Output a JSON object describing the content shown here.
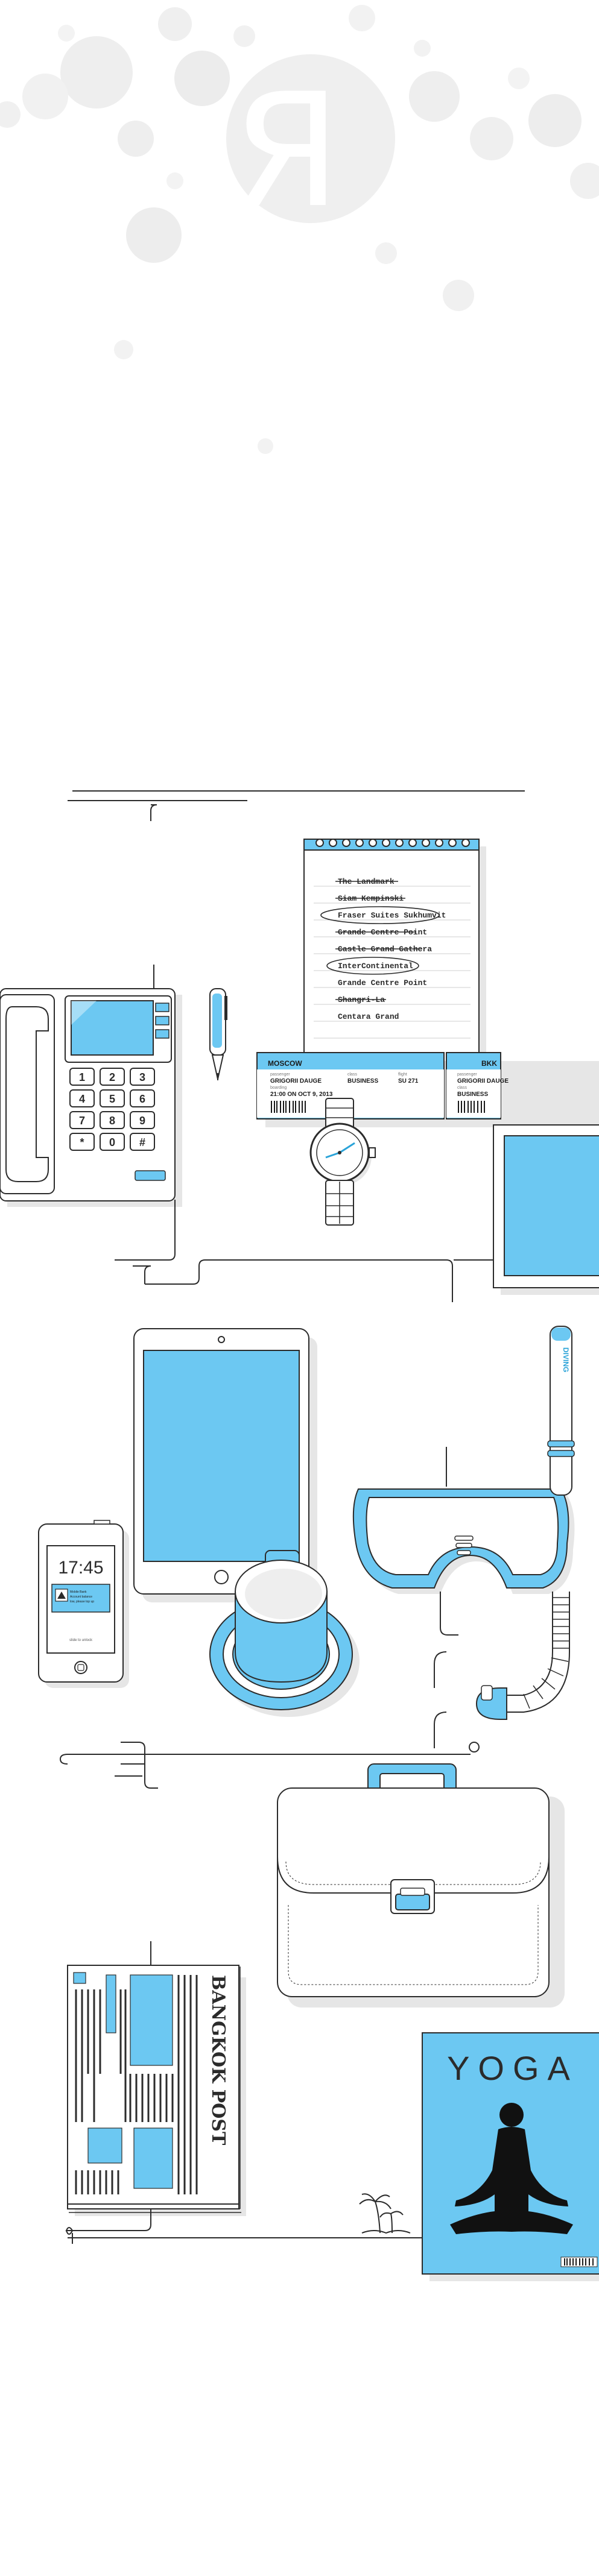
{
  "colors": {
    "accent": "#6cc8f2",
    "accent_dark": "#2aa3d8",
    "ink": "#2b2b2b",
    "shadow": "#e6e6e6",
    "bubble": "#f0f0f0"
  },
  "header": {
    "logo_letter": "Я"
  },
  "notepad": {
    "items": [
      {
        "text": "The Landmark",
        "state": "struck"
      },
      {
        "text": "Siam Kempinski",
        "state": "struck"
      },
      {
        "text": "Fraser Suites Sukhumvit",
        "state": "circled"
      },
      {
        "text": "Grande Centre Point",
        "state": "struck"
      },
      {
        "text": "Castle Grand Gathera",
        "state": "struck"
      },
      {
        "text": "InterContinental",
        "state": "circled"
      },
      {
        "text": "Grande Centre Point",
        "state": "plain"
      },
      {
        "text": "Shangri-La",
        "state": "struck"
      },
      {
        "text": "Centara Grand",
        "state": "plain"
      }
    ]
  },
  "ticket": {
    "from": "MOSCOW",
    "to": "BKK",
    "passenger_label": "passenger",
    "passenger": "GRIGORII DAUGE",
    "class_label": "class",
    "class": "BUSINESS",
    "flight_label": "flight",
    "flight": "SU 271",
    "boarding_label": "boarding",
    "boarding": "21:00 ON OCT 9, 2013",
    "stub_passenger_label": "passenger",
    "stub_passenger": "GRIGORII DAUGE",
    "stub_class_label": "class",
    "stub_class": "BUSINESS"
  },
  "phone": {
    "keys": [
      "1",
      "2",
      "3",
      "4",
      "5",
      "6",
      "7",
      "8",
      "9",
      "*",
      "0",
      "#"
    ]
  },
  "smartphone": {
    "time": "17:45",
    "notification_line1": "Mobile Bank",
    "notification_line2": "Account balance",
    "notification_line3": "low, please top up",
    "slide_label": "slide to unlock"
  },
  "snorkel": {
    "brand": "DIVING"
  },
  "newspaper": {
    "masthead": "BANGKOK POST"
  },
  "yoga": {
    "title": "YOGA"
  }
}
